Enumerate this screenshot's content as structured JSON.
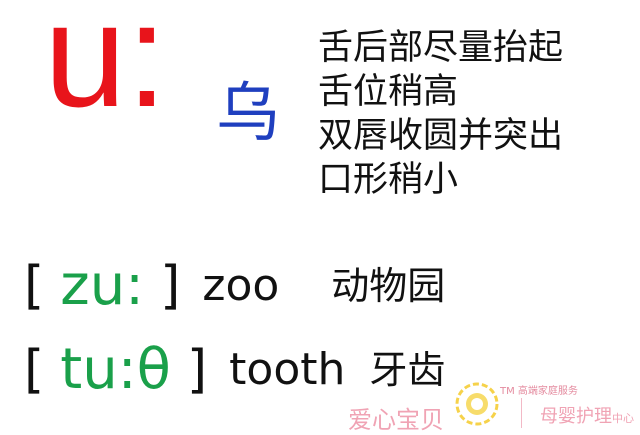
{
  "phoneme": "u:",
  "chinese_hint": "乌",
  "description": [
    "舌后部尽量抬起",
    "舌位稍高",
    "双唇收圆并突出",
    "口形稍小"
  ],
  "examples": [
    {
      "ipa": "zu:",
      "word": "zoo",
      "meaning": "动物园"
    },
    {
      "ipa": "tu:θ",
      "word": "tooth",
      "meaning": "牙齿"
    }
  ],
  "brackets": {
    "open": "[",
    "close": "]"
  },
  "watermark": {
    "brand": "爱心宝贝",
    "tagline": "TM 高端家庭服务",
    "service": "母婴护理",
    "service_suffix": "中心"
  },
  "colors": {
    "phoneme": "#e8141b",
    "hint": "#1f3fbf",
    "ipa": "#1aa04a",
    "watermark": "#f0a3b4"
  }
}
